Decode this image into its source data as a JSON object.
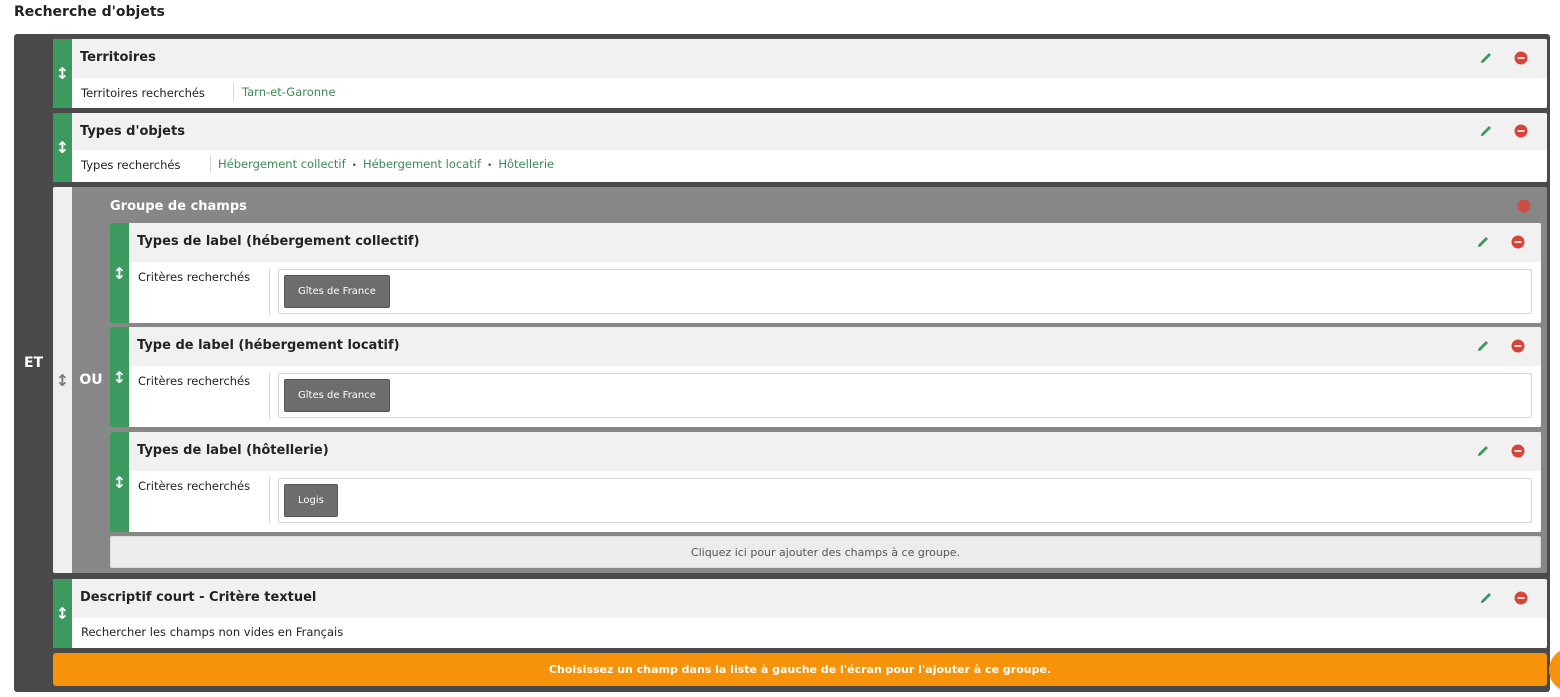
{
  "page_title": "Recherche d'objets",
  "root": {
    "operator": "ET"
  },
  "blocks": [
    {
      "title": "Territoires",
      "criteria_label": "Territoires recherchés",
      "values": [
        "Tarn-et-Garonne"
      ]
    },
    {
      "title": "Types d'objets",
      "criteria_label": "Types recherchés",
      "values": [
        "Hébergement collectif",
        "Hébergement locatif",
        "Hôtellerie"
      ]
    }
  ],
  "group": {
    "title": "Groupe de champs",
    "operator": "OU",
    "items": [
      {
        "title": "Types de label (hébergement collectif)",
        "criteria_label": "Critères recherchés",
        "chip": "Gîtes de France"
      },
      {
        "title": "Type de label (hébergement locatif)",
        "criteria_label": "Critères recherchés",
        "chip": "Gîtes de France"
      },
      {
        "title": "Types de label (hôtellerie)",
        "criteria_label": "Critères recherchés",
        "chip": "Logis"
      }
    ],
    "add_fields_label": "Cliquez ici pour ajouter des champs à ce groupe."
  },
  "text_block": {
    "title": "Descriptif court - Critère textuel",
    "description": "Rechercher les champs non vides en Français"
  },
  "footer_hint": "Choisissez un champ dans la liste à gauche de l'écran pour l'ajouter à ce groupe.",
  "icons": {
    "drag": "drag-handle-icon",
    "edit": "pencil-icon",
    "delete": "minus-circle-icon"
  },
  "colors": {
    "green": "#3d9a5f",
    "red": "#d9443a",
    "orange": "#f7930a",
    "dark": "#4a4a4a",
    "group": "#878787"
  }
}
